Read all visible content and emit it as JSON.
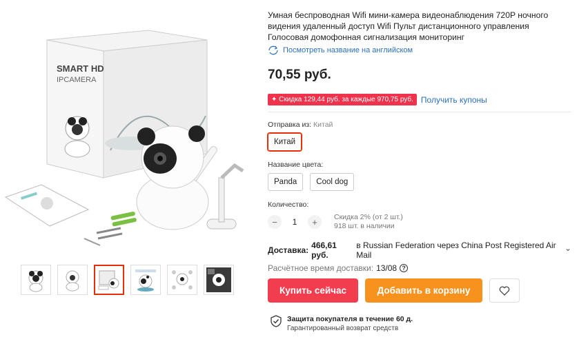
{
  "product": {
    "title": "Умная беспроводная Wifi мини-камера видеонаблюдения 720P ночного видения удаленный доступ Wifi Пульт дистанционного управления Голосовая домофонная сигнализация мониторинг",
    "translate_link": "Посмотреть название на английском",
    "price": "70,55 руб.",
    "coupon_badge": "Скидка 129,44 руб. за каждые 970,75 руб.",
    "coupon_link": "Получить купоны"
  },
  "box_text": {
    "brand": "SMART HD",
    "sub": "IPCAMERA"
  },
  "shipping": {
    "label": "Отправка из:",
    "value": "Китай",
    "option": "Китай"
  },
  "color": {
    "label": "Название цвета:",
    "options": [
      "Panda",
      "Cool dog"
    ]
  },
  "quantity": {
    "label": "Количество:",
    "value": "1",
    "minus": "−",
    "plus": "+",
    "note_discount": "Скидка 2% (от 2 шт.)",
    "note_stock": "918 шт. в наличии"
  },
  "delivery": {
    "label": "Доставка:",
    "price": "466,61 руб.",
    "details": "в Russian Federation через China Post Registered Air Mail",
    "chevron": "⌄",
    "eta_label": "Расчётное время доставки:",
    "eta_date": "13/08",
    "help": "?"
  },
  "actions": {
    "buy": "Купить сейчас",
    "cart": "Добавить в корзину"
  },
  "protection": {
    "title": "Защита покупателя в течение 60 д.",
    "subtitle": "Гарантированный возврат средств"
  },
  "colors": {
    "accent_red": "#f23d4f",
    "accent_orange": "#f7921e",
    "link_blue": "#2a6fb8",
    "selected_border": "#e62e04"
  }
}
